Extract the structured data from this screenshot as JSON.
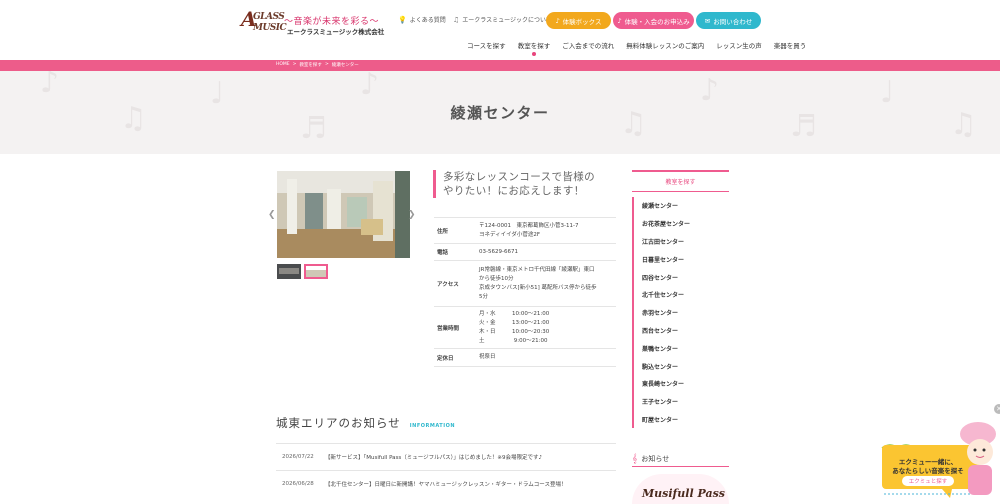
{
  "header": {
    "logo_mark": "GLASS MUSIC",
    "logo_tagline": "〜音楽が未来を彩る〜",
    "logo_company": "エークラスミュージック株式会社",
    "links": [
      {
        "label": "よくある質問",
        "icon": "lightbulb-icon"
      },
      {
        "label": "エークラスミュージックについて",
        "icon": "music-note-icon"
      }
    ],
    "buttons": [
      {
        "label": "体験ボックス",
        "icon": "music-note-icon"
      },
      {
        "label": "体験・入会のお申込み",
        "icon": "music-note-icon"
      },
      {
        "label": "お問い合わせ",
        "icon": "mail-icon"
      }
    ],
    "nav": [
      "コースを探す",
      "教室を探す",
      "ご入会までの流れ",
      "無料体験レッスンのご案内",
      "レッスン生の声",
      "楽器を買う"
    ],
    "nav_active_index": 1
  },
  "breadcrumb": [
    "HOME",
    "教室を探す",
    "綾瀬センター"
  ],
  "hero": {
    "title": "綾瀬センター"
  },
  "catch_copy": [
    "多彩なレッスンコースで皆様の",
    "やりたい！にお応えします！"
  ],
  "info": {
    "address_label": "住所",
    "address_lines": [
      "〒124-0001　東京都葛飾区小菅3-11-7",
      "ヨネディイイダ小菅途2F"
    ],
    "phone_label": "電話",
    "phone": "03-5629-6671",
    "access_label": "アクセス",
    "access_lines": [
      "JR常磐線・東京メトロ千代田線「綾瀬駅」東口",
      "から徒歩10分",
      "京成タウンバス[新小51] 葛配所バス停から徒歩",
      "5分"
    ],
    "hours_label": "営業時間",
    "hours_lines": [
      "月・水　　　10:00〜21:00",
      "火・金　　　13:00〜21:00",
      "木・日　　　10:00〜20:30",
      "土　　　　　 9:00〜21:00"
    ],
    "closed_label": "定休日",
    "closed": "祝祭日"
  },
  "sidebar": {
    "heading": "教室を探す",
    "centers": [
      "綾瀬センター",
      "お花茶屋センター",
      "江古田センター",
      "日暮里センター",
      "四谷センター",
      "北千住センター",
      "赤羽センター",
      "西台センター",
      "巣鴨センター",
      "駒込センター",
      "東長崎センター",
      "王子センター",
      "町屋センター"
    ],
    "news_label": "お知らせ",
    "banner_text": "Musifull Pass"
  },
  "news": {
    "title": "城東エリアのお知らせ",
    "title_en": "INFORMATION",
    "items": [
      {
        "date": "2026/07/22",
        "text": "【新サービス】「Musifull Pass（ミュージフルパス）」はじめました！※9会場限定です♪"
      },
      {
        "date": "2026/06/28",
        "text": "【北千住センター】日曜日に新開講！ヤマハミュージックレッスン・ギター・ドラムコース登場！"
      }
    ]
  },
  "float_widget": {
    "bubble_lines": [
      "エクミュー一緒に、",
      "あなたらしい音楽を探そう！"
    ],
    "button_label": "エクミュと探す"
  },
  "colors": {
    "accent_pink": "#ef5b8f",
    "accent_orange": "#f2a81d",
    "accent_teal": "#2fb8cd"
  }
}
